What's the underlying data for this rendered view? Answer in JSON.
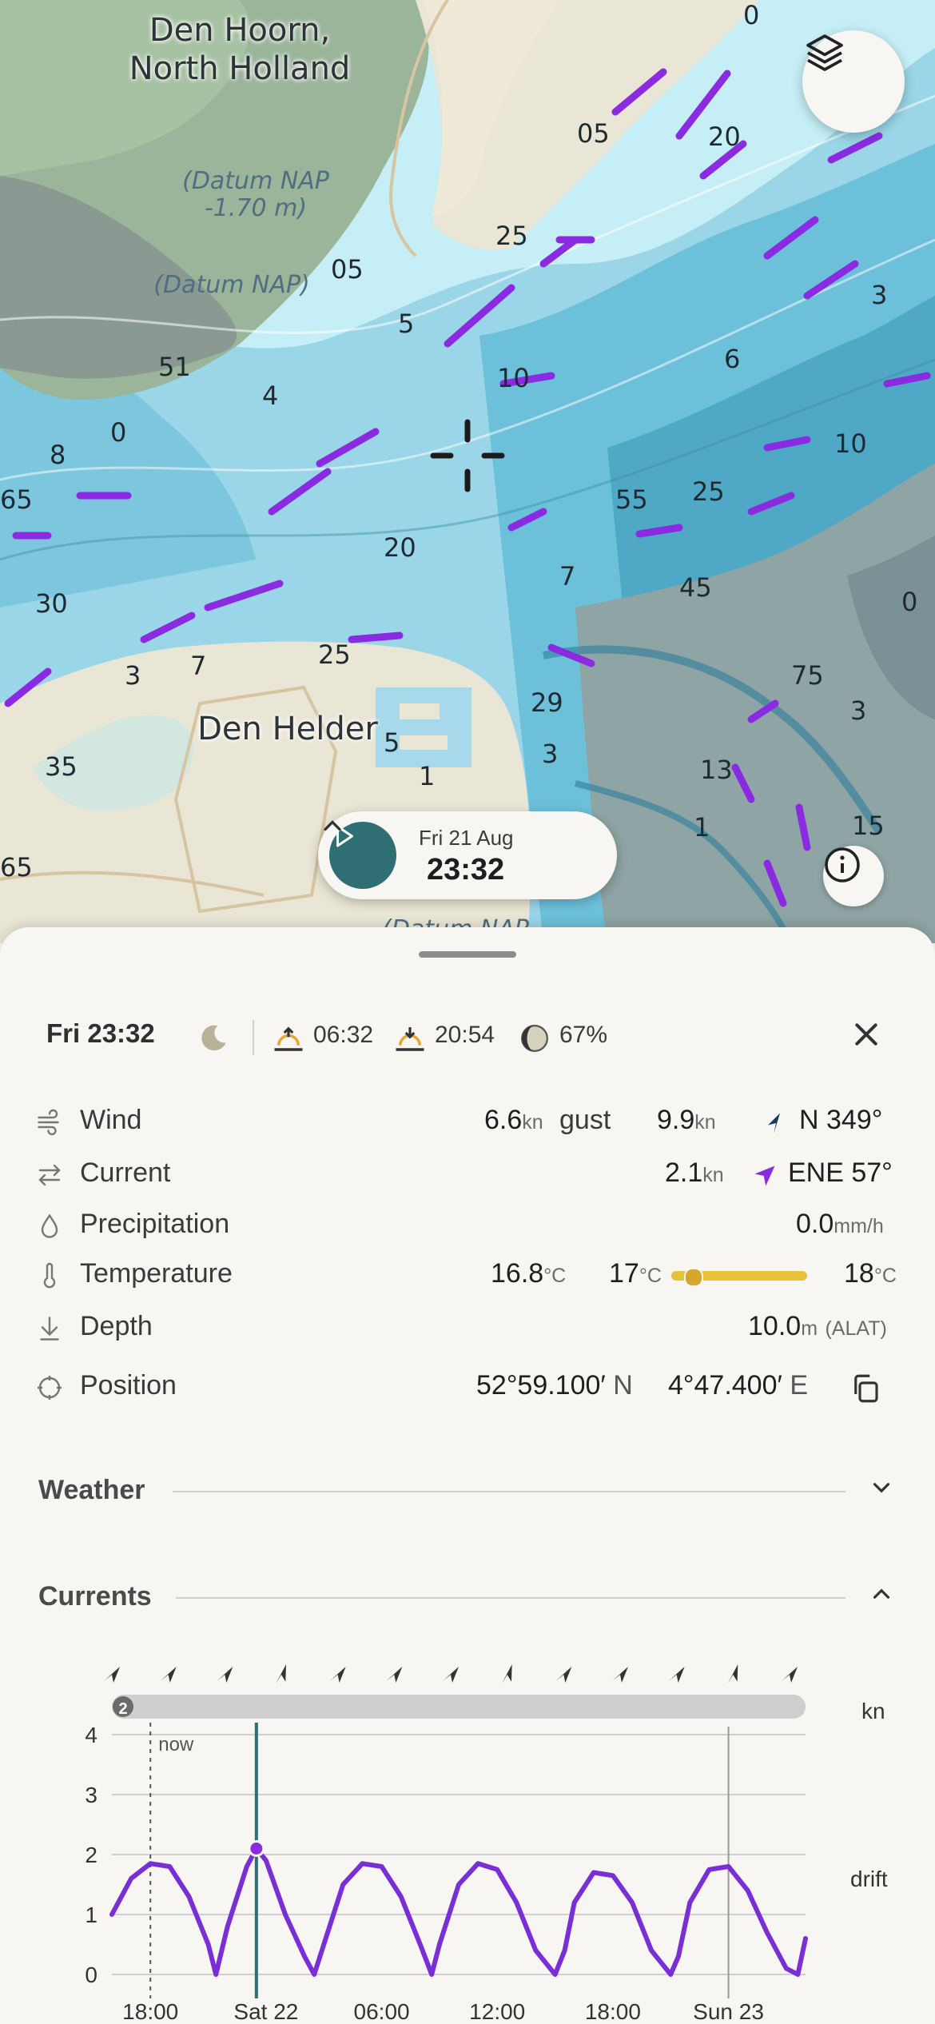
{
  "map": {
    "places": [
      "Den Hoorn,",
      "North Holland",
      "Den Helder"
    ],
    "datums": [
      "(Datum NAP",
      "-1.70 m)",
      "(Datum NAP)",
      "(Datum NAP"
    ],
    "depths": [
      "05",
      "20",
      "25",
      "05",
      "5",
      "3",
      "51",
      "4",
      "0",
      "10",
      "6",
      "8",
      "65",
      "10",
      "55",
      "25",
      "20",
      "7",
      "45",
      "0",
      "30",
      "3",
      "7",
      "25",
      "29",
      "75",
      "3",
      "35",
      "5",
      "1",
      "3",
      "13",
      "1",
      "15",
      "65",
      "0"
    ],
    "icons": {
      "layers": "layers-icon",
      "info": "info-icon",
      "crosshair": "crosshair-icon",
      "play": "play-icon"
    }
  },
  "time_pill": {
    "date": "Fri 21 Aug",
    "time": "23:32"
  },
  "header": {
    "time": "Fri 23:32",
    "sunrise": "06:32",
    "sunset": "20:54",
    "moon": "67%"
  },
  "conditions": {
    "wind": {
      "label": "Wind",
      "speed": "6.6",
      "unit": "kn",
      "gust_label": "gust",
      "gust": "9.9",
      "gust_unit": "kn",
      "dir": "N 349°"
    },
    "current": {
      "label": "Current",
      "speed": "2.1",
      "unit": "kn",
      "dir": "ENE 57°"
    },
    "precip": {
      "label": "Precipitation",
      "value": "0.0",
      "unit": "mm/h"
    },
    "temp": {
      "label": "Temperature",
      "value": "16.8",
      "unit": "°C",
      "min": "17",
      "min_unit": "°C",
      "max": "18",
      "max_unit": "°C",
      "level": 0.15
    },
    "depth": {
      "label": "Depth",
      "value": "10.0",
      "unit": "m",
      "ref": "(ALAT)"
    },
    "position": {
      "label": "Position",
      "lat": "52°59.100′",
      "lat_dir": "N",
      "lon": "4°47.400′",
      "lon_dir": "E"
    }
  },
  "sections": {
    "weather": "Weather",
    "currents": "Currents"
  },
  "colors": {
    "accent": "#2f6e73",
    "current": "#7a2fd6",
    "temp_bar": "#e6c13a"
  },
  "chart_data": {
    "type": "line",
    "title": "",
    "ylabel": "kn",
    "series_label": "drift",
    "now_label": "now",
    "badge": "2",
    "ylim": [
      0,
      4
    ],
    "yticks": [
      "0",
      "1",
      "2",
      "3",
      "4"
    ],
    "x_tick_labels": [
      "18:00",
      "Sat 22",
      "06:00",
      "12:00",
      "18:00",
      "Sun 23"
    ],
    "x_tick_hours": [
      0,
      6,
      12,
      18,
      24,
      30
    ],
    "x_range_hours": [
      -2.0,
      34.0
    ],
    "now_hour": 0,
    "selected_hour": 5.5,
    "selected_value": 2.1,
    "day_line_hour": 30,
    "series": [
      {
        "x": [
          -2,
          -1,
          0,
          1,
          2,
          3,
          3.4,
          4,
          5,
          5.5,
          6,
          7,
          8,
          8.5,
          9,
          10,
          11,
          12,
          13,
          14,
          14.6,
          15,
          16,
          17,
          18,
          19,
          20,
          21,
          21.5,
          22,
          23,
          24,
          25,
          26,
          27,
          27.4,
          28,
          29,
          30,
          31,
          32,
          33,
          33.6,
          34
        ],
        "y": [
          1.0,
          1.6,
          1.85,
          1.8,
          1.3,
          0.5,
          0,
          0.8,
          1.8,
          2.1,
          1.9,
          1.0,
          0.3,
          0,
          0.5,
          1.5,
          1.85,
          1.8,
          1.3,
          0.5,
          0,
          0.5,
          1.5,
          1.85,
          1.75,
          1.2,
          0.4,
          0,
          0.4,
          1.2,
          1.7,
          1.65,
          1.2,
          0.4,
          0,
          0.3,
          1.2,
          1.75,
          1.8,
          1.4,
          0.7,
          0.1,
          0,
          0.6
        ]
      }
    ],
    "direction_arrows": [
      "ne",
      "ne",
      "ne",
      "n",
      "ne",
      "ne",
      "ne",
      "n",
      "ne",
      "ne",
      "ne",
      "n",
      "ne"
    ]
  }
}
